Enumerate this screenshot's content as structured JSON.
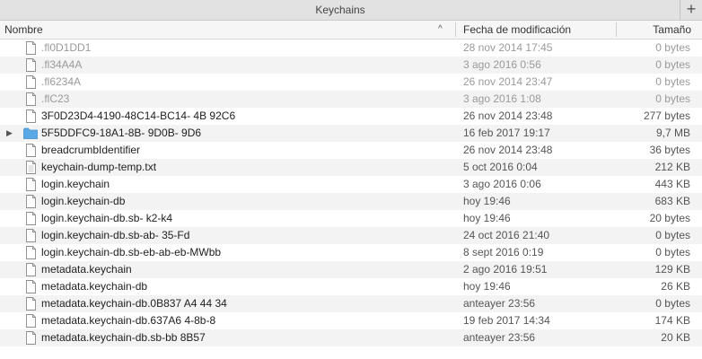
{
  "window": {
    "title": "Keychains",
    "add_label": "+"
  },
  "columns": {
    "name": "Nombre",
    "date": "Fecha de modificación",
    "size": "Tamaño",
    "sort_indicator": "^"
  },
  "disclosure_glyph": "▶",
  "colors": {
    "folder": "#5aa9e6",
    "file_border": "#8c8c8c",
    "alt_row": "#f3f3f3",
    "dim_text": "#9a9a9a"
  },
  "rows": [
    {
      "name": ".fl0D1DD1",
      "date": "28 nov 2014 17:45",
      "size": "0 bytes",
      "kind": "file",
      "dim": true
    },
    {
      "name": ".fl34A4A",
      "date": "3 ago 2016 0:56",
      "size": "0 bytes",
      "kind": "file",
      "dim": true
    },
    {
      "name": ".fl6234A",
      "date": "26 nov 2014 23:47",
      "size": "0 bytes",
      "kind": "file",
      "dim": true
    },
    {
      "name": ".flC23",
      "date": "3 ago 2016 1:08",
      "size": "0 bytes",
      "kind": "file",
      "dim": true
    },
    {
      "name": "3F0D23D4-4190-48C14-BC14-  4B  92C6",
      "date": "26 nov 2014 23:48",
      "size": "277 bytes",
      "kind": "file"
    },
    {
      "name": "5F5DDFC9-18A1-8B-  9D0B-  9D6",
      "date": "16 feb 2017 19:17",
      "size": "9,7 MB",
      "kind": "folder"
    },
    {
      "name": "breadcrumbIdentifier",
      "date": "26 nov 2014 23:48",
      "size": "36 bytes",
      "kind": "file"
    },
    {
      "name": "keychain-dump-temp.txt",
      "date": "5 oct 2016 0:04",
      "size": "212 KB",
      "kind": "text"
    },
    {
      "name": "login.keychain",
      "date": "3 ago 2016 0:06",
      "size": "443 KB",
      "kind": "file"
    },
    {
      "name": "login.keychain-db",
      "date": "hoy 19:46",
      "size": "683 KB",
      "kind": "file"
    },
    {
      "name": "login.keychain-db.sb-  k2-k4",
      "date": "hoy 19:46",
      "size": "20 bytes",
      "kind": "file"
    },
    {
      "name": "login.keychain-db.sb-ab-  35-Fd",
      "date": "24 oct 2016 21:40",
      "size": "0 bytes",
      "kind": "file"
    },
    {
      "name": "login.keychain-db.sb-eb-ab-eb-MWbb",
      "date": "8 sept 2016 0:19",
      "size": "0 bytes",
      "kind": "file"
    },
    {
      "name": "metadata.keychain",
      "date": "2 ago 2016 19:51",
      "size": "129 KB",
      "kind": "file"
    },
    {
      "name": "metadata.keychain-db",
      "date": "hoy 19:46",
      "size": "26 KB",
      "kind": "file"
    },
    {
      "name": "metadata.keychain-db.0B837  A4  44 34",
      "date": "anteayer 23:56",
      "size": "0 bytes",
      "kind": "file"
    },
    {
      "name": "metadata.keychain-db.637A6  4-8b-8",
      "date": "19 feb 2017 14:34",
      "size": "174 KB",
      "kind": "file"
    },
    {
      "name": "metadata.keychain-db.sb-bb  8B57",
      "date": "anteayer 23:56",
      "size": "20 KB",
      "kind": "file"
    }
  ]
}
